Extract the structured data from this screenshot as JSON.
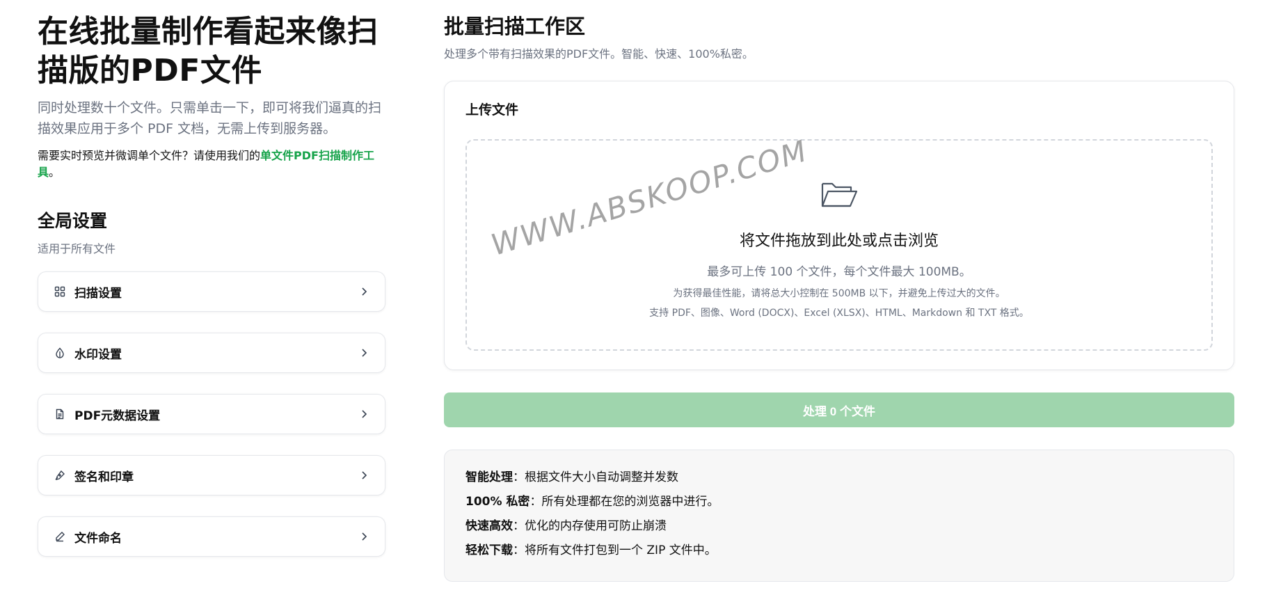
{
  "left": {
    "title": "在线批量制作看起来像扫描版的PDF文件",
    "subtitle": "同时处理数十个文件。只需单击一下，即可将我们逼真的扫描效果应用于多个 PDF 文档，无需上传到服务器。",
    "hint_prefix": "需要实时预览并微调单个文件？请使用我们的",
    "hint_link": "单文件PDF扫描制作工具",
    "hint_suffix": "。",
    "section_title": "全局设置",
    "section_sub": "适用于所有文件",
    "settings": [
      {
        "label": "扫描设置",
        "icon": "grid-icon"
      },
      {
        "label": "水印设置",
        "icon": "droplet-icon"
      },
      {
        "label": "PDF元数据设置",
        "icon": "document-icon"
      },
      {
        "label": "签名和印章",
        "icon": "pen-icon"
      },
      {
        "label": "文件命名",
        "icon": "edit-icon"
      }
    ]
  },
  "right": {
    "title": "批量扫描工作区",
    "subtitle": "处理多个带有扫描效果的PDF文件。智能、快速、100%私密。",
    "upload": {
      "title": "上传文件",
      "drop_title": "将文件拖放到此处或点击浏览",
      "line1": "最多可上传 100 个文件，每个文件最大 100MB。",
      "line2": "为获得最佳性能，请将总大小控制在 500MB 以下，并避免上传过大的文件。",
      "line3": "支持 PDF、图像、Word (DOCX)、Excel (XLSX)、HTML、Markdown 和 TXT 格式。"
    },
    "watermark": "WWW.ABSKOOP.COM",
    "process_button": "处理 0 个文件",
    "features": [
      {
        "key": "智能处理",
        "value": "：根据文件大小自动调整并发数"
      },
      {
        "key": "100% 私密",
        "value": "：所有处理都在您的浏览器中进行。"
      },
      {
        "key": "快速高效",
        "value": "：优化的内存使用可防止崩溃"
      },
      {
        "key": "轻松下载",
        "value": "：将所有文件打包到一个 ZIP 文件中。"
      }
    ]
  },
  "colors": {
    "accent_green": "#16a34a",
    "button_disabled": "#9fd5ad"
  }
}
